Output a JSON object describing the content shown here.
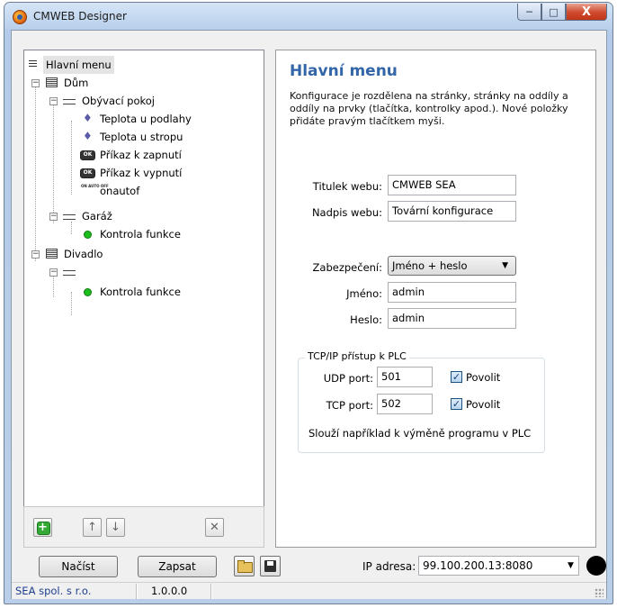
{
  "window": {
    "title": "CMWEB Designer",
    "caption": {
      "minimize": "─",
      "maximize": "□",
      "close": "X"
    }
  },
  "tree": {
    "root": "Hlavní menu",
    "dum": "Dům",
    "obyvaci": "Obývací pokoj",
    "teplota_podlahy": "Teplota u podlahy",
    "teplota_stropu": "Teplota u stropu",
    "prikaz_zapnuti": "Příkaz k zapnutí",
    "prikaz_vypnuti": "Příkaz k vypnutí",
    "onautof": "onautof",
    "garaz": "Garáž",
    "kontrola1": "Kontrola funkce",
    "divadlo": "Divadlo",
    "kontrola2": "Kontrola funkce"
  },
  "tree_toolbar": {
    "add": "+",
    "up": "↑",
    "down": "↓",
    "delete": "✕"
  },
  "detail": {
    "heading": "Hlavní menu",
    "description": "Konfigurace je rozdělena na stránky, stránky na oddíly a oddíly na prvky (tlačítka, kontrolky apod.). Nové položky přidáte pravým tlačítkem myši.",
    "titulek_label": "Titulek webu:",
    "titulek_value": "CMWEB SEA",
    "nadpis_label": "Nadpis webu:",
    "nadpis_value": "Tovární konfigurace",
    "zabezpeceni_label": "Zabezpečení:",
    "zabezpeceni_value": "Jméno + heslo",
    "jmeno_label": "Jméno:",
    "jmeno_value": "admin",
    "heslo_label": "Heslo:",
    "heslo_value": "admin",
    "tcp_group_title": "TCP/IP přístup k PLC",
    "udp_label": "UDP port:",
    "udp_value": "501",
    "udp_enable": "Povolit",
    "tcp_label": "TCP port:",
    "tcp_value": "502",
    "tcp_enable": "Povolit",
    "tcp_note": "Slouží například k výměně programu v PLC"
  },
  "bottom": {
    "load": "Načíst",
    "write": "Zapsat",
    "ip_label": "IP adresa:",
    "ip_value": "99.100.200.13:8080"
  },
  "status": {
    "company": "SEA spol. s r.o.",
    "version": "1.0.0.0"
  }
}
